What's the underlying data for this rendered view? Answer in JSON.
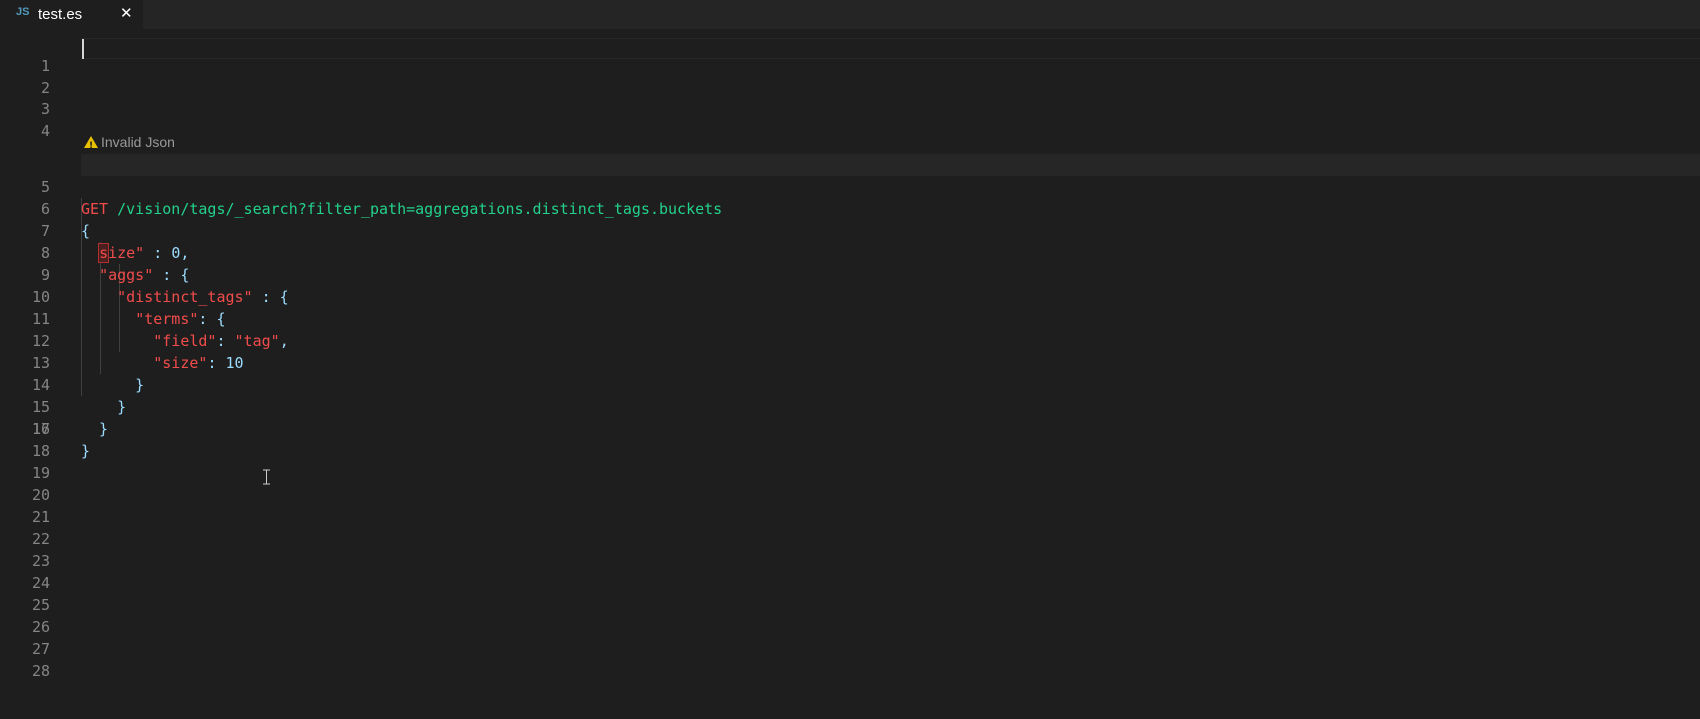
{
  "tab": {
    "icon_label": "JS",
    "title": "test.es",
    "close_glyph": "✕"
  },
  "codelens": {
    "text": "Invalid Json",
    "icon": "warning-icon"
  },
  "lines": [
    {
      "n": "1"
    },
    {
      "n": "2"
    },
    {
      "n": "3"
    },
    {
      "n": "4"
    },
    {
      "n": "5",
      "method": "GET",
      "url": " /vision/tags/_search?filter_path=aggregations.distinct_tags.buckets"
    },
    {
      "n": "6",
      "code": "{"
    },
    {
      "n": "7"
    },
    {
      "n": "8"
    },
    {
      "n": "9"
    },
    {
      "n": "10"
    },
    {
      "n": "11"
    },
    {
      "n": "12"
    },
    {
      "n": "13",
      "code": "      }"
    },
    {
      "n": "14",
      "code": "    }"
    },
    {
      "n": "15",
      "code": "  }"
    },
    {
      "n": "16",
      "code": "}"
    },
    {
      "n": "17"
    },
    {
      "n": "18"
    },
    {
      "n": "19"
    },
    {
      "n": "20"
    },
    {
      "n": "21"
    },
    {
      "n": "22"
    },
    {
      "n": "23"
    },
    {
      "n": "24"
    },
    {
      "n": "25"
    },
    {
      "n": "26"
    },
    {
      "n": "27"
    },
    {
      "n": "28"
    }
  ],
  "body": {
    "l7": {
      "err": "s",
      "key_rest": "ize\"",
      "punct": " : ",
      "num": "0",
      "tail": ","
    },
    "l8": {
      "key": "\"aggs\"",
      "punct": " : {"
    },
    "l9": {
      "key": "\"distinct_tags\"",
      "punct": " : {"
    },
    "l10": {
      "key": "\"terms\"",
      "punct": ": {"
    },
    "l11": {
      "key": "\"field\"",
      "punct": ": ",
      "str": "\"tag\"",
      "tail": ","
    },
    "l12": {
      "key": "\"size\"",
      "punct": ": ",
      "num": "10"
    }
  },
  "colors": {
    "background": "#1e1e1e",
    "tabbar": "#252526",
    "keyword_red": "#f14c4c",
    "url_green": "#23d18b",
    "punct_blue": "#9cdcfe",
    "line_number": "#858585"
  }
}
